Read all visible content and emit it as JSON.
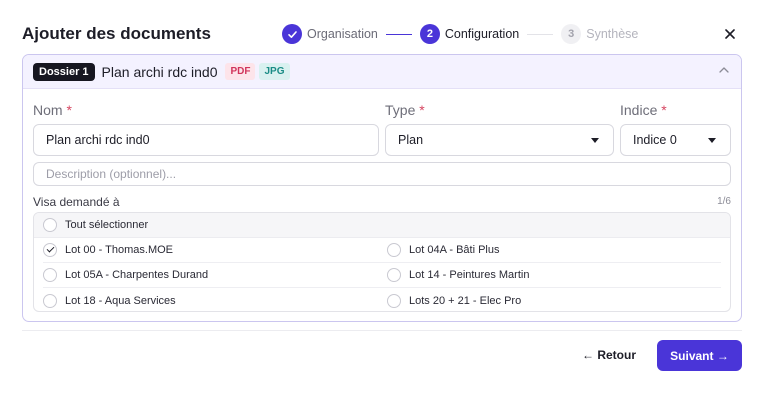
{
  "header": {
    "title": "Ajouter des documents",
    "close_icon": "close-icon"
  },
  "stepper": {
    "steps": [
      {
        "number": "✓",
        "label": "Organisation",
        "state": "done"
      },
      {
        "number": "2",
        "label": "Configuration",
        "state": "active"
      },
      {
        "number": "3",
        "label": "Synthèse",
        "state": "todo"
      }
    ]
  },
  "card": {
    "dossier_badge": "Dossier 1",
    "doc_name": "Plan archi rdc ind0",
    "tags": [
      "PDF",
      "JPG"
    ],
    "collapse_icon": "chevron-up-icon"
  },
  "form": {
    "nom": {
      "label": "Nom",
      "required": "*",
      "value": "Plan archi rdc ind0"
    },
    "type": {
      "label": "Type",
      "required": "*",
      "value": "Plan"
    },
    "indice": {
      "label": "Indice",
      "required": "*",
      "value": "Indice 0"
    },
    "description": {
      "placeholder": "Description (optionnel)..."
    }
  },
  "visa": {
    "label": "Visa demandé à",
    "count": "1/6",
    "select_all": "Tout sélectionner",
    "left": [
      {
        "label": "Lot 00 - Thomas.MOE",
        "checked": true
      },
      {
        "label": "Lot 05A - Charpentes Durand",
        "checked": false
      },
      {
        "label": "Lot 18 - Aqua Services",
        "checked": false
      }
    ],
    "right": [
      {
        "label": "Lot 04A - Bâti Plus",
        "checked": false
      },
      {
        "label": "Lot 14 - Peintures Martin",
        "checked": false
      },
      {
        "label": "Lots 20 + 21 - Elec Pro",
        "checked": false
      }
    ]
  },
  "footer": {
    "back_label": "← Retour",
    "next_label": "Suivant →"
  },
  "colors": {
    "accent": "#4a35d8",
    "card_border": "#cbc6ef",
    "required": "#d64661"
  }
}
